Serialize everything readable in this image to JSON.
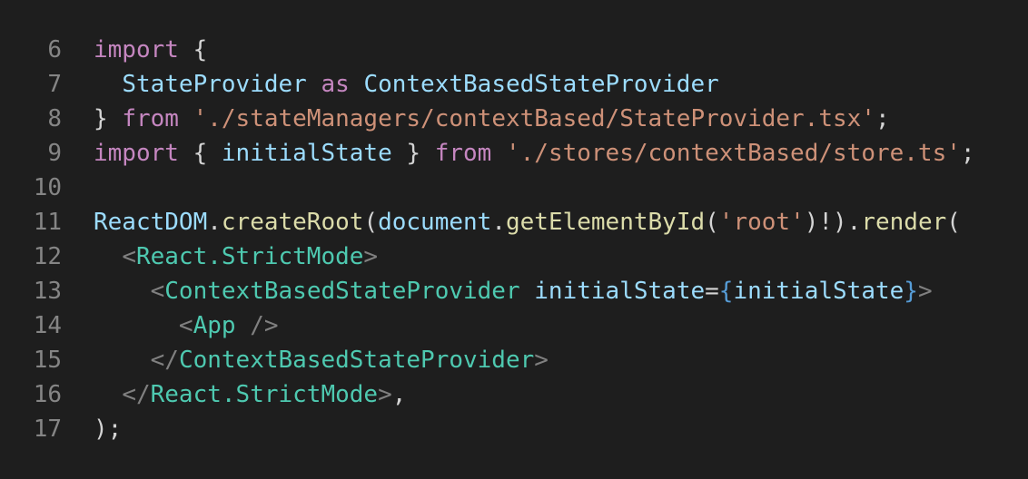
{
  "colors": {
    "background": "#1e1e1e",
    "line_number": "#858585",
    "default": "#d4d4d4",
    "keyword": "#c586c0",
    "variable": "#9cdcfe",
    "class": "#4ec9b0",
    "string": "#ce9178",
    "function": "#dcdcaa",
    "bracket": "#808080",
    "expression": "#569cd6"
  },
  "lines": [
    {
      "number": "6",
      "tokens": [
        {
          "text": "import",
          "kind": "kw"
        },
        {
          "text": " {",
          "kind": "pun"
        }
      ]
    },
    {
      "number": "7",
      "tokens": [
        {
          "text": "  ",
          "kind": "pun"
        },
        {
          "text": "StateProvider",
          "kind": "var"
        },
        {
          "text": " ",
          "kind": "pun"
        },
        {
          "text": "as",
          "kind": "kw"
        },
        {
          "text": " ",
          "kind": "pun"
        },
        {
          "text": "ContextBasedStateProvider",
          "kind": "var"
        }
      ]
    },
    {
      "number": "8",
      "tokens": [
        {
          "text": "} ",
          "kind": "pun"
        },
        {
          "text": "from",
          "kind": "kw"
        },
        {
          "text": " ",
          "kind": "pun"
        },
        {
          "text": "'./stateManagers/contextBased/StateProvider.tsx'",
          "kind": "str"
        },
        {
          "text": ";",
          "kind": "pun"
        }
      ]
    },
    {
      "number": "9",
      "tokens": [
        {
          "text": "import",
          "kind": "kw"
        },
        {
          "text": " { ",
          "kind": "pun"
        },
        {
          "text": "initialState",
          "kind": "var"
        },
        {
          "text": " } ",
          "kind": "pun"
        },
        {
          "text": "from",
          "kind": "kw"
        },
        {
          "text": " ",
          "kind": "pun"
        },
        {
          "text": "'./stores/contextBased/store.ts'",
          "kind": "str"
        },
        {
          "text": ";",
          "kind": "pun"
        }
      ]
    },
    {
      "number": "10",
      "tokens": []
    },
    {
      "number": "11",
      "tokens": [
        {
          "text": "ReactDOM",
          "kind": "var"
        },
        {
          "text": ".",
          "kind": "pun"
        },
        {
          "text": "createRoot",
          "kind": "fn"
        },
        {
          "text": "(",
          "kind": "pun"
        },
        {
          "text": "document",
          "kind": "var"
        },
        {
          "text": ".",
          "kind": "pun"
        },
        {
          "text": "getElementById",
          "kind": "fn"
        },
        {
          "text": "(",
          "kind": "pun"
        },
        {
          "text": "'root'",
          "kind": "str"
        },
        {
          "text": ")!).",
          "kind": "pun"
        },
        {
          "text": "render",
          "kind": "fn"
        },
        {
          "text": "(",
          "kind": "pun"
        }
      ]
    },
    {
      "number": "12",
      "tokens": [
        {
          "text": "  ",
          "kind": "pun"
        },
        {
          "text": "<",
          "kind": "brk"
        },
        {
          "text": "React.StrictMode",
          "kind": "cls"
        },
        {
          "text": ">",
          "kind": "brk"
        }
      ]
    },
    {
      "number": "13",
      "tokens": [
        {
          "text": "    ",
          "kind": "pun"
        },
        {
          "text": "<",
          "kind": "brk"
        },
        {
          "text": "ContextBasedStateProvider",
          "kind": "cls"
        },
        {
          "text": " ",
          "kind": "pun"
        },
        {
          "text": "initialState",
          "kind": "var"
        },
        {
          "text": "=",
          "kind": "pun"
        },
        {
          "text": "{",
          "kind": "expr"
        },
        {
          "text": "initialState",
          "kind": "var"
        },
        {
          "text": "}",
          "kind": "expr"
        },
        {
          "text": ">",
          "kind": "brk"
        }
      ]
    },
    {
      "number": "14",
      "tokens": [
        {
          "text": "      ",
          "kind": "pun"
        },
        {
          "text": "<",
          "kind": "brk"
        },
        {
          "text": "App",
          "kind": "cls"
        },
        {
          "text": " ",
          "kind": "pun"
        },
        {
          "text": "/>",
          "kind": "brk"
        }
      ]
    },
    {
      "number": "15",
      "tokens": [
        {
          "text": "    ",
          "kind": "pun"
        },
        {
          "text": "</",
          "kind": "brk"
        },
        {
          "text": "ContextBasedStateProvider",
          "kind": "cls"
        },
        {
          "text": ">",
          "kind": "brk"
        }
      ]
    },
    {
      "number": "16",
      "tokens": [
        {
          "text": "  ",
          "kind": "pun"
        },
        {
          "text": "</",
          "kind": "brk"
        },
        {
          "text": "React.StrictMode",
          "kind": "cls"
        },
        {
          "text": ">",
          "kind": "brk"
        },
        {
          "text": ",",
          "kind": "pun"
        }
      ]
    },
    {
      "number": "17",
      "tokens": [
        {
          "text": ");",
          "kind": "pun"
        }
      ]
    }
  ]
}
